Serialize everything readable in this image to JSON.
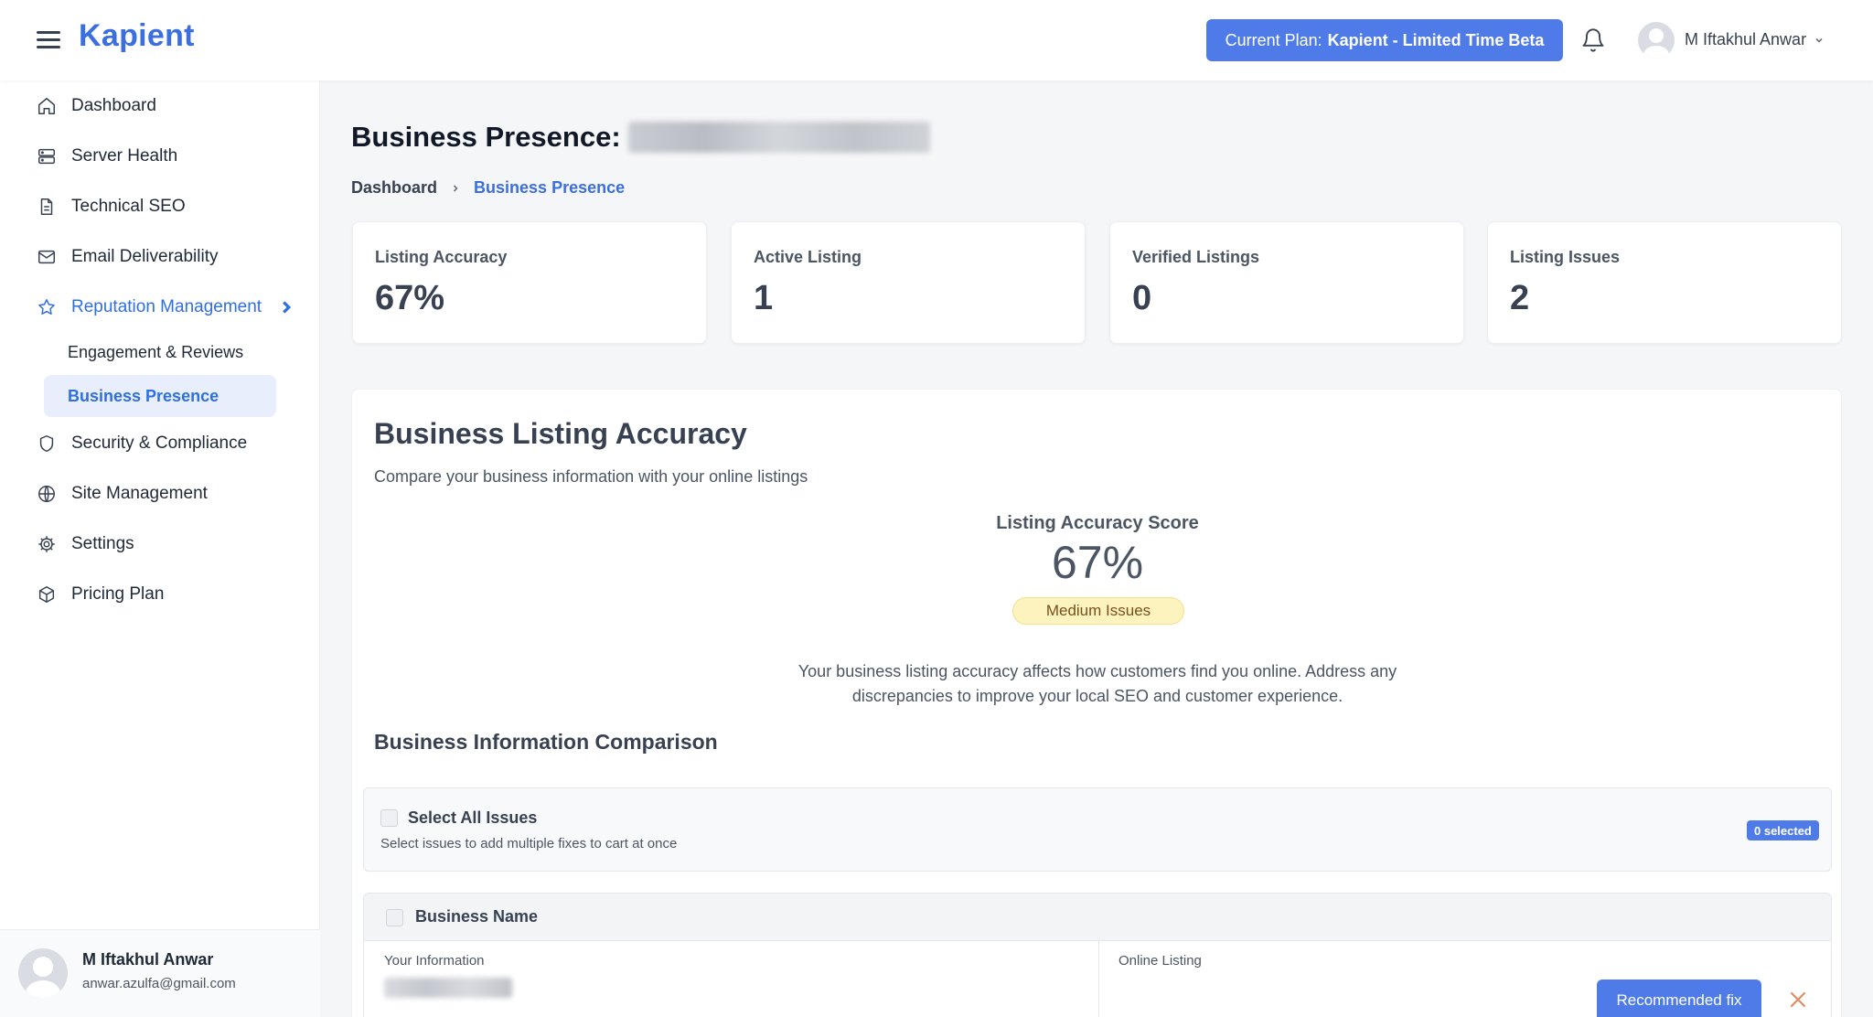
{
  "app": {
    "brand": "Kapient",
    "plan_prefix": "Current Plan:",
    "plan_name": "Kapient - Limited Time Beta",
    "user_name": "M Iftakhul Anwar"
  },
  "sidebar": {
    "items": [
      {
        "label": "Dashboard",
        "icon": "home-icon"
      },
      {
        "label": "Server Health",
        "icon": "server-icon"
      },
      {
        "label": "Technical SEO",
        "icon": "document-icon"
      },
      {
        "label": "Email Deliverability",
        "icon": "mail-icon"
      },
      {
        "label": "Reputation Management",
        "icon": "star-icon"
      },
      {
        "label": "Security & Compliance",
        "icon": "shield-icon"
      },
      {
        "label": "Site Management",
        "icon": "globe-icon"
      },
      {
        "label": "Settings",
        "icon": "gear-icon"
      },
      {
        "label": "Pricing Plan",
        "icon": "package-icon"
      }
    ],
    "subitems": [
      "Engagement & Reviews",
      "Business Presence"
    ],
    "footer": {
      "name": "M Iftakhul Anwar",
      "email": "anwar.azulfa@gmail.com"
    }
  },
  "page": {
    "title": "Business Presence:",
    "breadcrumb": [
      "Dashboard",
      "Business Presence"
    ]
  },
  "stats": [
    {
      "label": "Listing Accuracy",
      "value": "67%"
    },
    {
      "label": "Active Listing",
      "value": "1"
    },
    {
      "label": "Verified Listings",
      "value": "0"
    },
    {
      "label": "Listing Issues",
      "value": "2"
    }
  ],
  "accuracy": {
    "title": "Business Listing Accuracy",
    "subtitle": "Compare your business information with your online listings",
    "score_label": "Listing Accuracy Score",
    "score_value": "67%",
    "badge": "Medium Issues",
    "note": "Your business listing accuracy affects how customers find you online. Address any discrepancies to improve your local SEO and customer experience.",
    "comparison_title": "Business Information Comparison",
    "select_all": "Select All Issues",
    "select_hint": "Select issues to add multiple fixes to cart at once",
    "selected_count": "0 selected",
    "field_name": "Business Name",
    "your_info_label": "Your Information",
    "online_label": "Online Listing",
    "fix_button": "Recommended fix"
  },
  "colors": {
    "accent": "#4f7be8",
    "brand": "#3b6fe0",
    "badge_bg": "#fdf3bf"
  }
}
